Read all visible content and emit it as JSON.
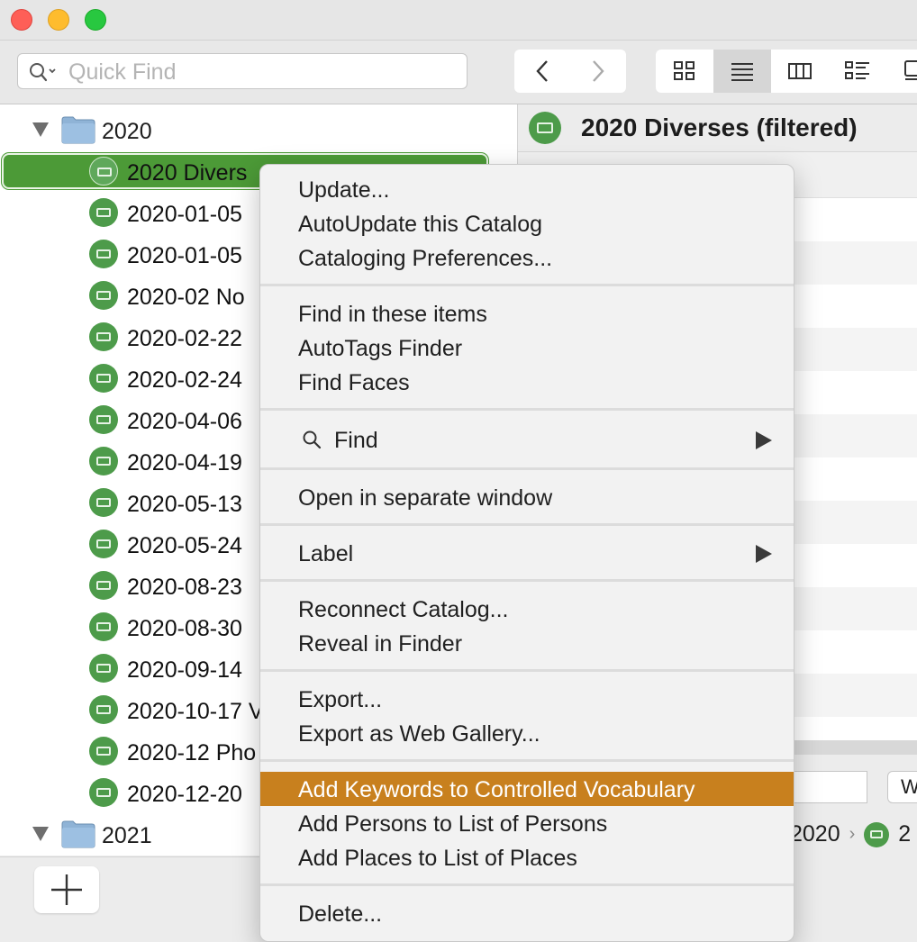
{
  "toolbar": {
    "search_placeholder": "Quick Find",
    "nav": [
      "back-arrow",
      "forward-arrow"
    ],
    "views": [
      "icon-grid",
      "list",
      "columns",
      "detail-list",
      "preview"
    ],
    "active_view": "list"
  },
  "sidebar": {
    "folder_2020": "2020",
    "selected_item": "2020 Divers",
    "items": [
      "2020-01-05",
      "2020-01-05",
      "2020-02 No",
      "2020-02-22",
      "2020-02-24",
      "2020-04-06",
      "2020-04-19",
      "2020-05-13",
      "2020-05-24",
      "2020-08-23",
      "2020-08-30",
      "2020-09-14",
      "2020-10-17 V",
      "2020-12 Pho",
      "2020-12-20"
    ],
    "folder_2021": "2021",
    "add_button": "+"
  },
  "right_pane": {
    "title": "2020 Diverses  (filtered)",
    "button_partial": "W",
    "path_year": "2020",
    "path_sep": "›",
    "path_tail": "2"
  },
  "menu": {
    "update": "Update...",
    "autoupdate": "AutoUpdate this Catalog",
    "prefs": "Cataloging Preferences...",
    "find_items": "Find in these items",
    "autotags": "AutoTags Finder",
    "find_faces": "Find Faces",
    "find": "Find",
    "open_window": "Open in separate window",
    "label": "Label",
    "reconnect": "Reconnect Catalog...",
    "reveal": "Reveal in Finder",
    "export": "Export...",
    "export_web": "Export as Web Gallery...",
    "add_keywords": "Add Keywords to Controlled Vocabulary",
    "add_persons": "Add Persons to List of Persons",
    "add_places": "Add Places to List of Places",
    "delete": "Delete..."
  },
  "colors": {
    "selection_green": "#4c9a37",
    "menu_highlight": "#c8801e",
    "catalog_icon": "#4d9b4a",
    "folder_blue": "#8fb3d6"
  }
}
